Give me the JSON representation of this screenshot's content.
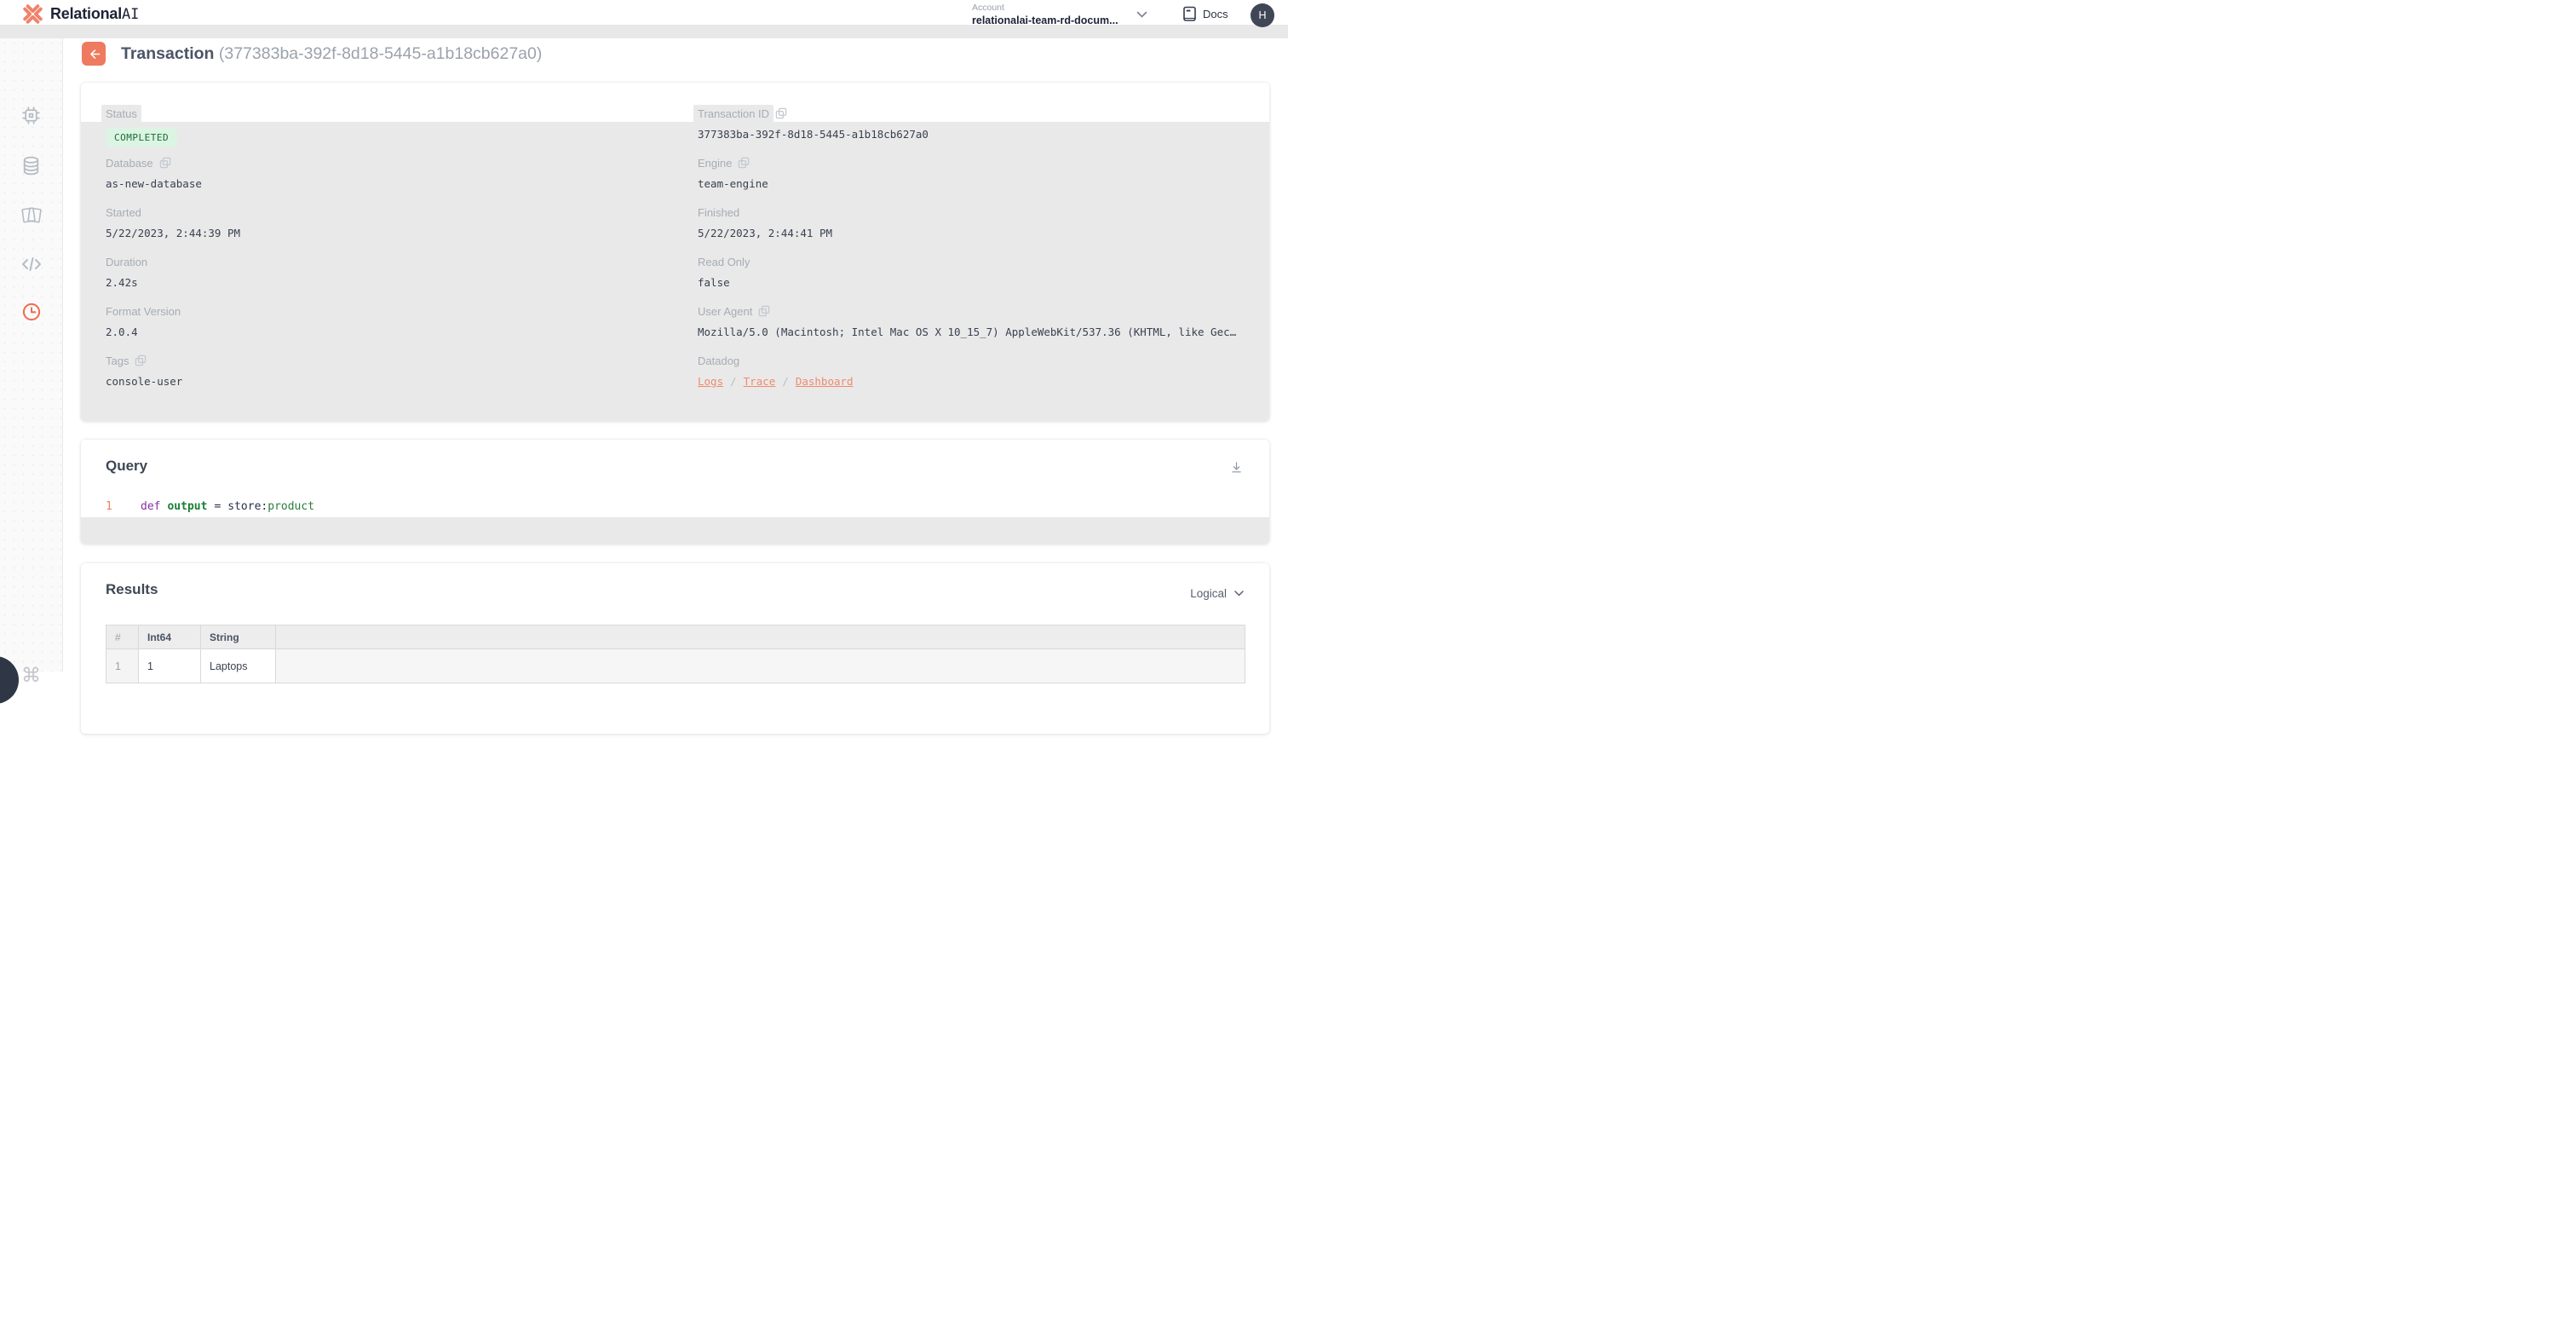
{
  "brand": {
    "name_bold": "Relational",
    "name_light": "AI"
  },
  "topbar": {
    "account_label": "Account",
    "account_value": "relationalai-team-rd-docum...",
    "docs_label": "Docs",
    "avatar_initial": "H"
  },
  "sidebar": {
    "items": [
      "engines",
      "databases",
      "worksheets",
      "editor",
      "transactions"
    ],
    "active_item": "transactions",
    "shortcut_glyph": "⌘"
  },
  "page_header": {
    "title": "Transaction",
    "title_id": "(377383ba-392f-8d18-5445-a1b18cb627a0)"
  },
  "details": {
    "status": {
      "label": "Status",
      "badge": "COMPLETED"
    },
    "transaction_id": {
      "label": "Transaction ID",
      "value": "377383ba-392f-8d18-5445-a1b18cb627a0"
    },
    "database": {
      "label": "Database",
      "value": "as-new-database"
    },
    "engine": {
      "label": "Engine",
      "value": "team-engine"
    },
    "started": {
      "label": "Started",
      "value": "5/22/2023, 2:44:39 PM"
    },
    "finished": {
      "label": "Finished",
      "value": "5/22/2023, 2:44:41 PM"
    },
    "duration": {
      "label": "Duration",
      "value": "2.42s"
    },
    "read_only": {
      "label": "Read Only",
      "value": "false"
    },
    "format_version": {
      "label": "Format Version",
      "value": "2.0.4"
    },
    "user_agent": {
      "label": "User Agent",
      "value": "Mozilla/5.0 (Macintosh; Intel Mac OS X 10_15_7) AppleWebKit/537.36 (KHTML, like Gec…"
    },
    "tags": {
      "label": "Tags",
      "value": "console-user"
    },
    "datadog": {
      "label": "Datadog",
      "separator": "/",
      "links": {
        "logs": "Logs",
        "trace": "Trace",
        "dashboard": "Dashboard"
      }
    }
  },
  "query": {
    "title": "Query",
    "line_number": "1",
    "code": {
      "keyword": "def",
      "name": "output",
      "operator": "=",
      "relation": "store",
      "colon": ":",
      "member": "product"
    }
  },
  "results": {
    "title": "Results",
    "view_mode": "Logical",
    "table": {
      "headers": {
        "index": "#",
        "col1": "Int64",
        "col2": "String"
      },
      "rows": [
        {
          "index": "1",
          "col1": "1",
          "col2": "Laptops"
        }
      ]
    }
  },
  "colors": {
    "accent_coral": "#ee7a5f",
    "badge_bg": "#dcf4e3",
    "badge_text": "#1a6b31",
    "panel_gray": "#e9e9e9",
    "navy": "#1d2336"
  }
}
